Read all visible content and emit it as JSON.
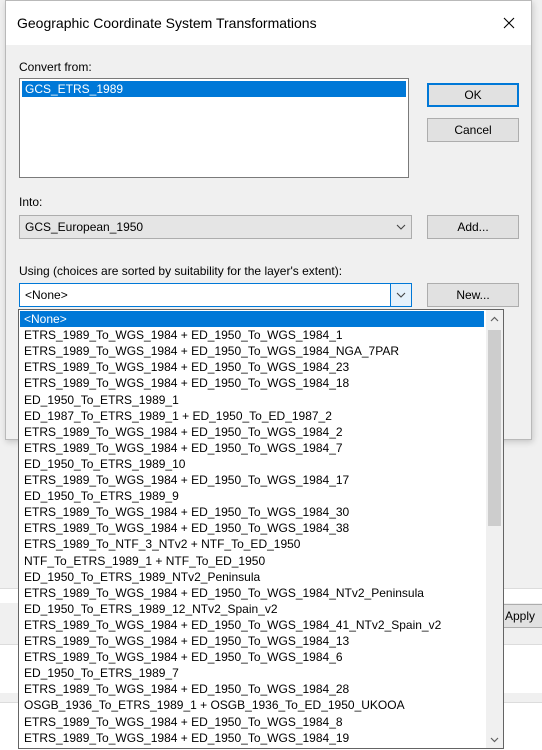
{
  "background": {
    "apply_label": "Apply"
  },
  "dialog": {
    "title": "Geographic Coordinate System Transformations",
    "convert_from": {
      "label": "Convert from:",
      "selected_item": "GCS_ETRS_1989"
    },
    "into": {
      "label": "Into:",
      "value": "GCS_European_1950"
    },
    "using": {
      "label": "Using (choices are sorted by suitability for the layer's extent):",
      "value": "<None>"
    },
    "buttons": {
      "ok": "OK",
      "cancel": "Cancel",
      "add": "Add...",
      "new": "New..."
    }
  },
  "dropdown": {
    "selected_index": 0,
    "items": [
      "<None>",
      "ETRS_1989_To_WGS_1984 + ED_1950_To_WGS_1984_1",
      "ETRS_1989_To_WGS_1984 + ED_1950_To_WGS_1984_NGA_7PAR",
      "ETRS_1989_To_WGS_1984 + ED_1950_To_WGS_1984_23",
      "ETRS_1989_To_WGS_1984 + ED_1950_To_WGS_1984_18",
      "ED_1950_To_ETRS_1989_1",
      "ED_1987_To_ETRS_1989_1 + ED_1950_To_ED_1987_2",
      "ETRS_1989_To_WGS_1984 + ED_1950_To_WGS_1984_2",
      "ETRS_1989_To_WGS_1984 + ED_1950_To_WGS_1984_7",
      "ED_1950_To_ETRS_1989_10",
      "ETRS_1989_To_WGS_1984 + ED_1950_To_WGS_1984_17",
      "ED_1950_To_ETRS_1989_9",
      "ETRS_1989_To_WGS_1984 + ED_1950_To_WGS_1984_30",
      "ETRS_1989_To_WGS_1984 + ED_1950_To_WGS_1984_38",
      "ETRS_1989_To_NTF_3_NTv2 + NTF_To_ED_1950",
      "NTF_To_ETRS_1989_1 + NTF_To_ED_1950",
      "ED_1950_To_ETRS_1989_NTv2_Peninsula",
      "ETRS_1989_To_WGS_1984 + ED_1950_To_WGS_1984_NTv2_Peninsula",
      "ED_1950_To_ETRS_1989_12_NTv2_Spain_v2",
      "ETRS_1989_To_WGS_1984 + ED_1950_To_WGS_1984_41_NTv2_Spain_v2",
      "ETRS_1989_To_WGS_1984 + ED_1950_To_WGS_1984_13",
      "ETRS_1989_To_WGS_1984 + ED_1950_To_WGS_1984_6",
      "ED_1950_To_ETRS_1989_7",
      "ETRS_1989_To_WGS_1984 + ED_1950_To_WGS_1984_28",
      "OSGB_1936_To_ETRS_1989_1 + OSGB_1936_To_ED_1950_UKOOA",
      "ETRS_1989_To_WGS_1984 + ED_1950_To_WGS_1984_8",
      "ETRS_1989_To_WGS_1984 + ED_1950_To_WGS_1984_19"
    ]
  },
  "icons": {
    "close": "close-icon",
    "chevron": "chevron-down-icon",
    "scroll_up": "scroll-up-arrow-icon",
    "scroll_down": "scroll-down-arrow-icon"
  },
  "colors": {
    "selection": "#0078d7",
    "button_face": "#e1e1e1",
    "dialog_bg": "#f0f0f0"
  }
}
